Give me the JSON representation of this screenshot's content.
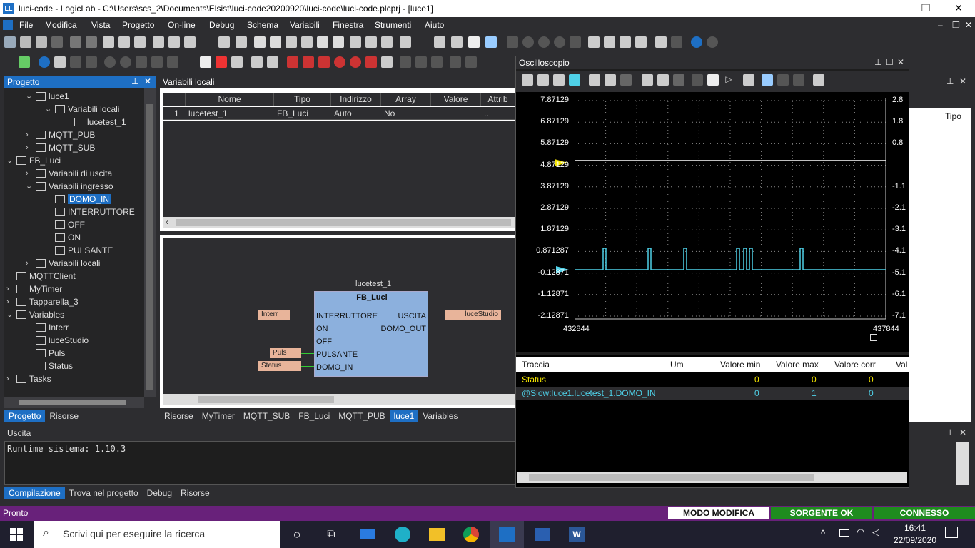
{
  "title": "luci-code - LogicLab - C:\\Users\\scs_2\\Documents\\Elsist\\luci-code20200920\\luci-code\\luci-code.plcprj - [luce1]",
  "menu": [
    "File",
    "Modifica",
    "Vista",
    "Progetto",
    "On-line",
    "Debug",
    "Schema",
    "Variabili",
    "Finestra",
    "Strumenti",
    "Aiuto"
  ],
  "project": {
    "title": "Progetto",
    "tree": [
      {
        "label": "luce1",
        "indent": 2,
        "chev": "⌄"
      },
      {
        "label": "Variabili locali",
        "indent": 3,
        "chev": "⌄"
      },
      {
        "label": "lucetest_1",
        "indent": 4,
        "chev": ""
      },
      {
        "label": "MQTT_PUB",
        "indent": 2,
        "chev": "›"
      },
      {
        "label": "MQTT_SUB",
        "indent": 2,
        "chev": "›"
      },
      {
        "label": "FB_Luci",
        "indent": 1,
        "chev": "⌄"
      },
      {
        "label": "Variabili di uscita",
        "indent": 2,
        "chev": "›"
      },
      {
        "label": "Variabili ingresso",
        "indent": 2,
        "chev": "⌄"
      },
      {
        "label": "DOMO_IN",
        "indent": 3,
        "chev": "",
        "sel": true
      },
      {
        "label": "INTERRUTTORE",
        "indent": 3,
        "chev": ""
      },
      {
        "label": "OFF",
        "indent": 3,
        "chev": ""
      },
      {
        "label": "ON",
        "indent": 3,
        "chev": ""
      },
      {
        "label": "PULSANTE",
        "indent": 3,
        "chev": ""
      },
      {
        "label": "Variabili locali",
        "indent": 2,
        "chev": "›"
      },
      {
        "label": "MQTTClient",
        "indent": 1,
        "chev": ""
      },
      {
        "label": "MyTimer",
        "indent": 1,
        "chev": "›"
      },
      {
        "label": "Tapparella_3",
        "indent": 1,
        "chev": "›"
      },
      {
        "label": "Variables",
        "indent": 1,
        "chev": "⌄"
      },
      {
        "label": "Interr",
        "indent": 2,
        "chev": ""
      },
      {
        "label": "luceStudio",
        "indent": 2,
        "chev": ""
      },
      {
        "label": "Puls",
        "indent": 2,
        "chev": ""
      },
      {
        "label": "Status",
        "indent": 2,
        "chev": ""
      },
      {
        "label": "Tasks",
        "indent": 1,
        "chev": "›"
      }
    ],
    "tabs": [
      "Progetto",
      "Risorse"
    ]
  },
  "locals": {
    "title": "Variabili locali",
    "headers": [
      "Nome",
      "Tipo",
      "Indirizzo",
      "Array",
      "Valore iniziale",
      "Attrib"
    ],
    "row": [
      "1",
      "lucetest_1",
      "FB_Luci",
      "Auto",
      "No",
      "",
      ".."
    ]
  },
  "fbd": {
    "instance": "lucetest_1",
    "type": "FB_Luci",
    "inputs": [
      "INTERRUTTORE",
      "ON",
      "OFF",
      "PULSANTE",
      "DOMO_IN"
    ],
    "outputs": [
      "USCITA",
      "DOMO_OUT"
    ],
    "tags_in": [
      "Interr",
      "Puls",
      "Status"
    ],
    "tag_out": "luceStudio"
  },
  "editor_tabs": [
    "Risorse",
    "MyTimer",
    "MQTT_SUB",
    "FB_Luci",
    "MQTT_PUB",
    "luce1",
    "Variables"
  ],
  "output": {
    "title": "Uscita",
    "text": "Runtime sistema: 1.10.3",
    "tabs": [
      "Compilazione",
      "Trova nel progetto",
      "Debug",
      "Risorse"
    ]
  },
  "scope": {
    "title": "Oscilloscopio",
    "yleft": [
      "7.87129",
      "6.87129",
      "5.87129",
      "4.87129",
      "3.87129",
      "2.87129",
      "1.87129",
      "0.871287",
      "-0.12871",
      "-1.12871",
      "-2.12871"
    ],
    "yright": [
      "2.8",
      "1.8",
      "0.8",
      "",
      "-1.1",
      "-2.1",
      "-3.1",
      "-4.1",
      "-5.1",
      "-6.1",
      "-7.1"
    ],
    "xmin": "432844",
    "xmax": "437844",
    "cols": [
      "Traccia",
      "Um",
      "Valore min",
      "Valore max",
      "Valore corr",
      "Val"
    ],
    "rows": [
      {
        "name": "Status",
        "um": "",
        "min": "0",
        "max": "0",
        "corr": "0"
      },
      {
        "name": "@Slow:luce1.lucetest_1.DOMO_IN",
        "um": "",
        "min": "0",
        "max": "1",
        "corr": "0"
      }
    ],
    "colors": {
      "status": "#f5e600",
      "domo": "#4fd1e8"
    }
  },
  "right_panel": {
    "col": "Tipo"
  },
  "status": {
    "left": "Pronto",
    "modo": "MODO MODIFICA",
    "sorgente": "SORGENTE OK",
    "connesso": "CONNESSO"
  },
  "taskbar": {
    "search": "Scrivi qui per eseguire la ricerca",
    "time": "16:41",
    "date": "22/09/2020"
  }
}
